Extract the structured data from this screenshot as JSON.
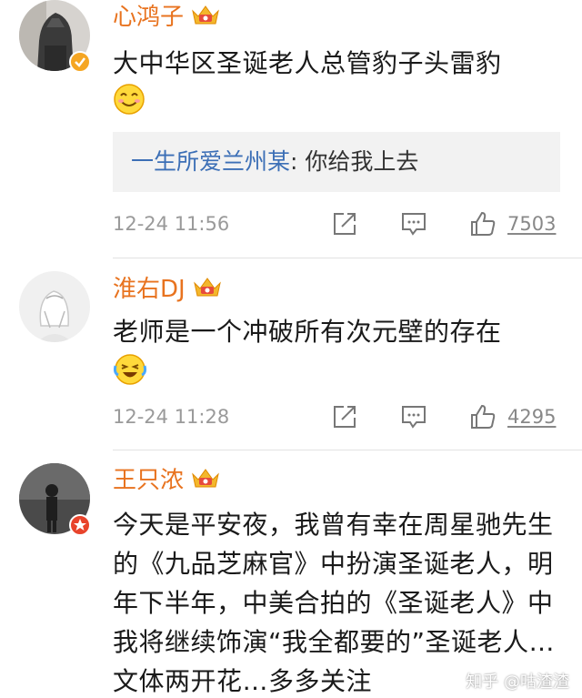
{
  "comments": [
    {
      "username": "心鸿子",
      "text": "大中华区圣诞老人总管豹子头雷豹",
      "emoji": "smile-emoji",
      "reply": {
        "author": "一生所爱兰州某",
        "separator": ": ",
        "text": "你给我上去"
      },
      "time": "12-24 11:56",
      "likes": "7503"
    },
    {
      "username": "淮右DJ",
      "text": "老师是一个冲破所有次元壁的存在",
      "emoji": "laugh-cry-emoji",
      "time": "12-24 11:28",
      "likes": "4295"
    },
    {
      "username": "王只浓",
      "text": "今天是平安夜，我曾有幸在周星驰先生的《九品芝麻官》中扮演圣诞老人，明年下半年，中美合拍的《圣诞老人》中我将继续饰演“我全都要的”圣诞老人…文体两开花…多多关注"
    }
  ],
  "watermark": "知乎 @咕渣渣",
  "colors": {
    "username": "#e8731f",
    "reply_author": "#3c6fb6",
    "meta": "#9a9a9a",
    "reply_bg": "#f2f2f2"
  }
}
